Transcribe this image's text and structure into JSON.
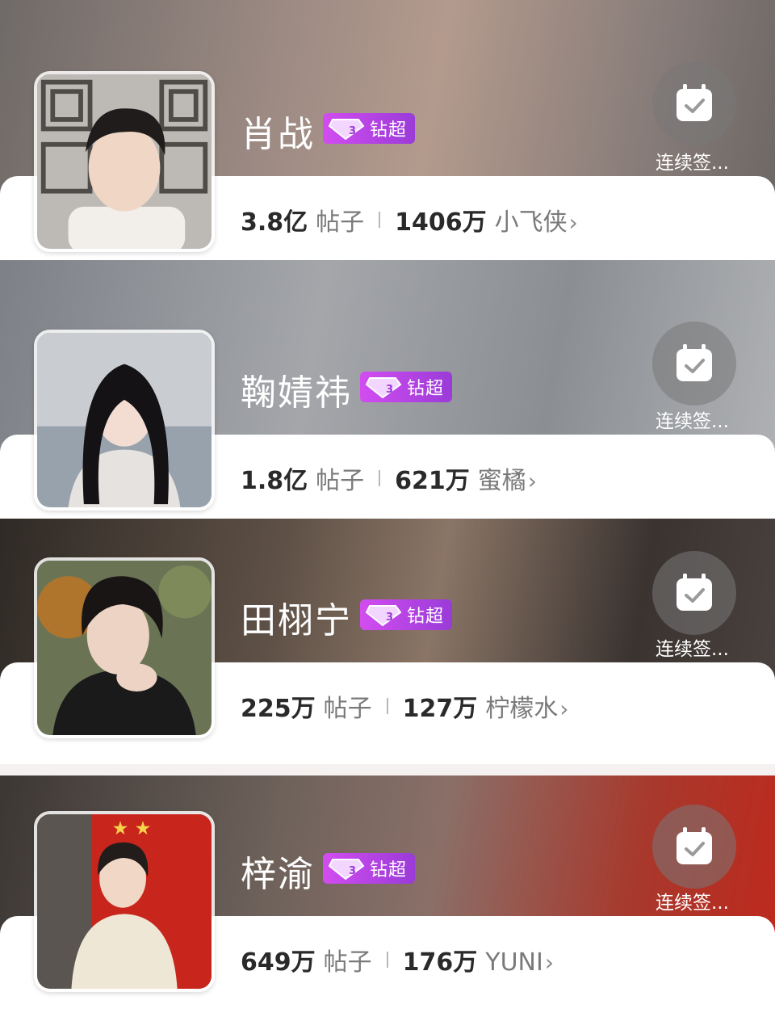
{
  "checkin_label": "连续签...",
  "badge_label": "钻超",
  "posts_label": "帖子",
  "colors": {
    "badge_start": "#d24df0",
    "badge_end": "#9a3bd8",
    "card1_bg": "#8a7770",
    "card2_bg": "#8e9297",
    "card3_bg": "#4a3e34",
    "card4_bg": "#b23a2c"
  },
  "cards": [
    {
      "name": "肖战",
      "posts_count": "3.8亿",
      "fans_count": "1406万",
      "fans_name": "小飞侠"
    },
    {
      "name": "鞠婧祎",
      "posts_count": "1.8亿",
      "fans_count": "621万",
      "fans_name": "蜜橘"
    },
    {
      "name": "田栩宁",
      "posts_count": "225万",
      "fans_count": "127万",
      "fans_name": "柠檬水"
    },
    {
      "name": "梓渝",
      "posts_count": "649万",
      "fans_count": "176万",
      "fans_name": "YUNI"
    }
  ]
}
